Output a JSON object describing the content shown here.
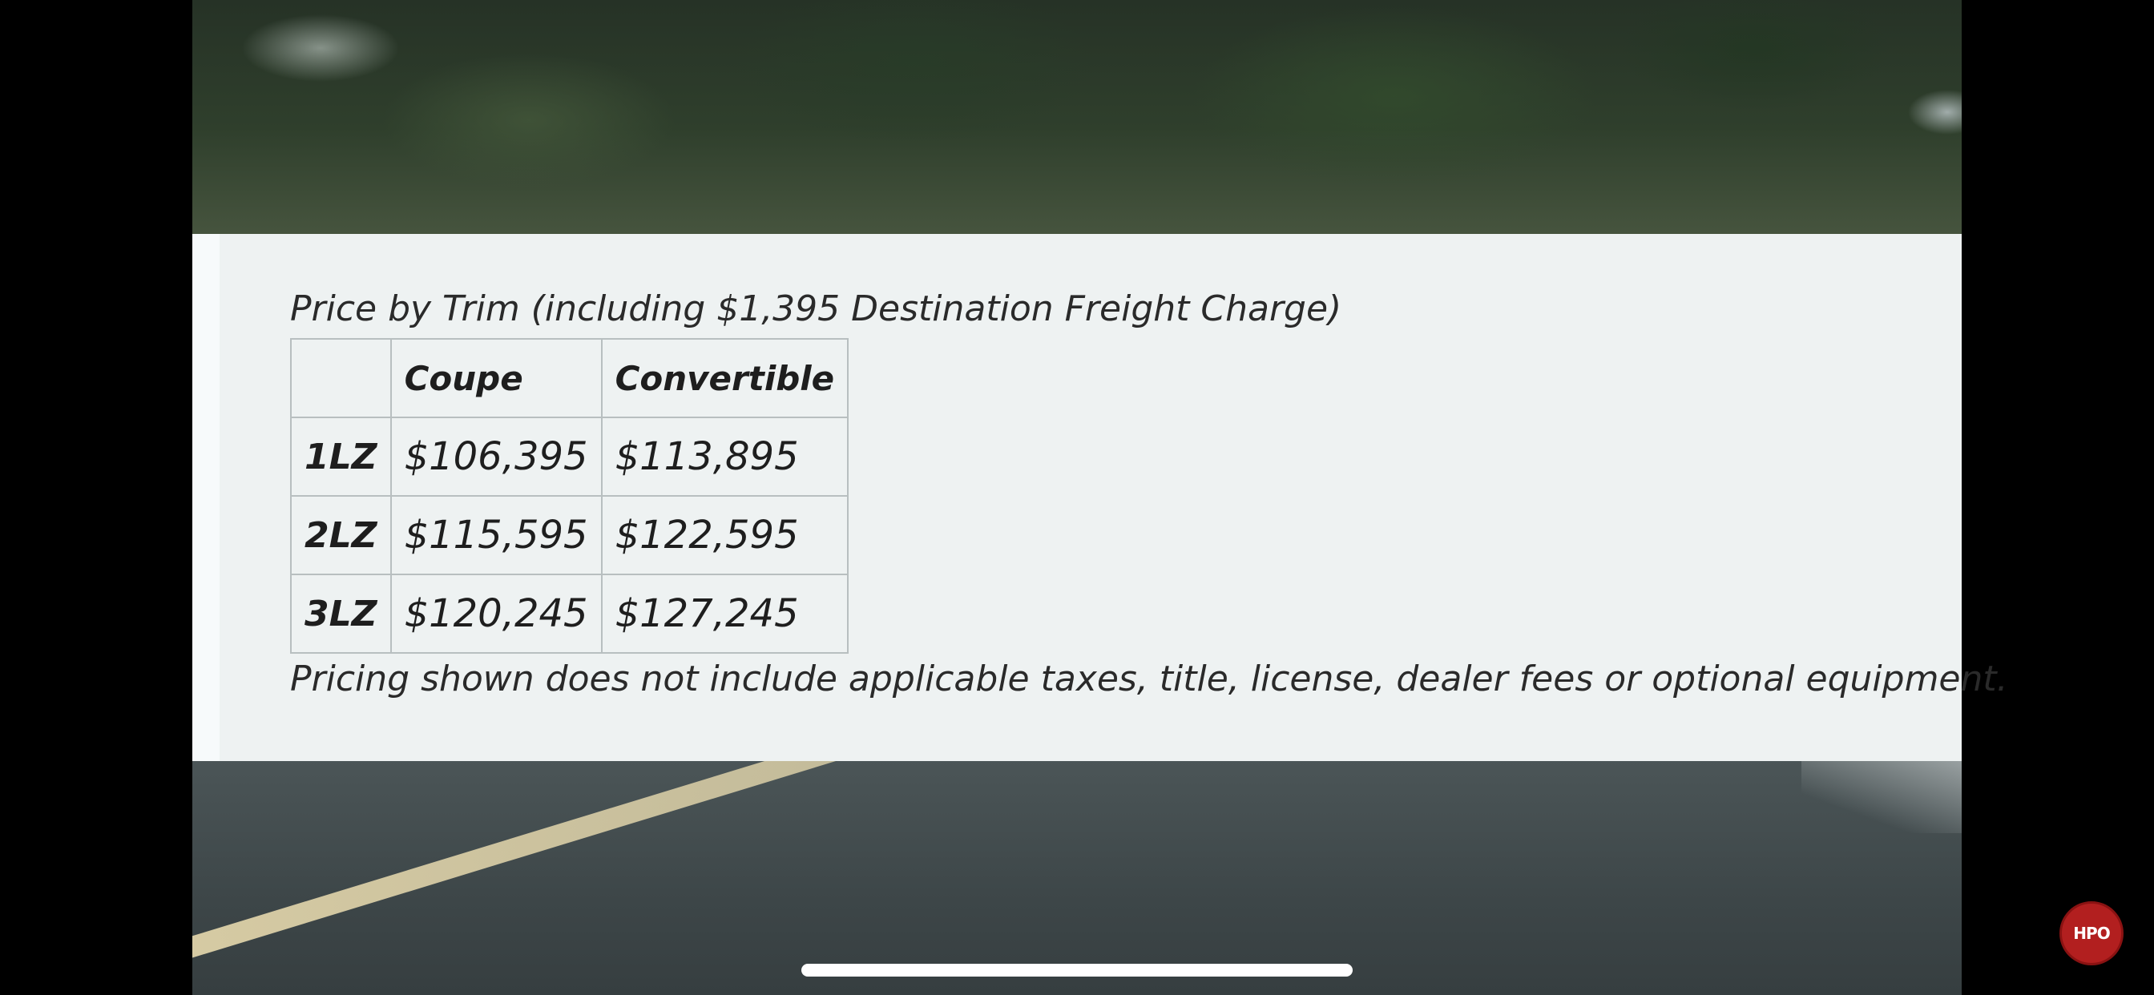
{
  "video": {
    "caption": "Price by Trim (including $1,395 Destination Freight Charge)",
    "price_table": {
      "headers": [
        "",
        "Coupe",
        "Convertible"
      ],
      "rows": [
        {
          "trim": "1LZ",
          "coupe": "$106,395",
          "convertible": "$113,895"
        },
        {
          "trim": "2LZ",
          "coupe": "$115,595",
          "convertible": "$122,595"
        },
        {
          "trim": "3LZ",
          "coupe": "$120,245",
          "convertible": "$127,245"
        }
      ]
    },
    "footnote": "Pricing shown does not include applicable taxes, title, license, dealer fees or optional equipment."
  },
  "watermark": {
    "logo_text": "HPO",
    "icon": "channel-logo-icon",
    "color": "#b21f1f"
  }
}
